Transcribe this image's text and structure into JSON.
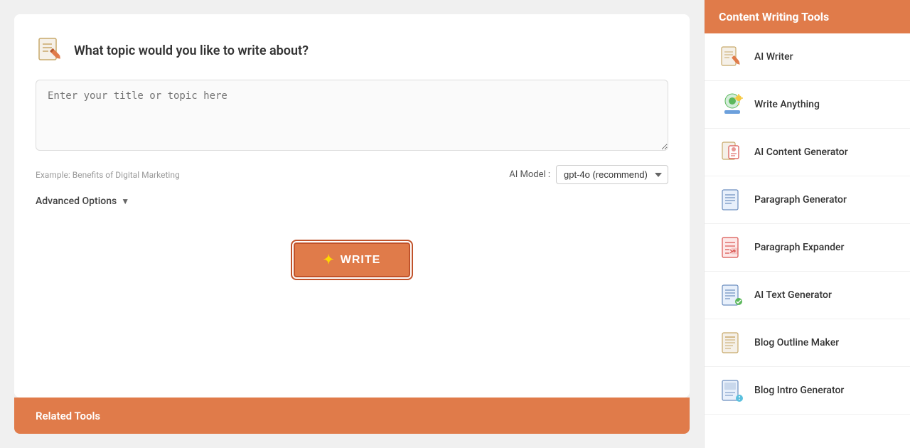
{
  "main": {
    "card": {
      "title": "What topic would you like to write about?",
      "input_placeholder": "Enter your title or topic here",
      "example_text": "Example: Benefits of Digital Marketing",
      "ai_model_label": "AI Model :",
      "ai_model_value": "gpt-4o (recommend)",
      "advanced_options_label": "Advanced Options",
      "write_button_label": "WRITE"
    },
    "related_tools_label": "Related Tools"
  },
  "sidebar": {
    "header": "Content Writing Tools",
    "items": [
      {
        "label": "AI Writer",
        "icon": "ai-writer-icon"
      },
      {
        "label": "Write Anything",
        "icon": "write-anything-icon"
      },
      {
        "label": "AI Content Generator",
        "icon": "ai-content-icon"
      },
      {
        "label": "Paragraph Generator",
        "icon": "paragraph-gen-icon"
      },
      {
        "label": "Paragraph Expander",
        "icon": "paragraph-exp-icon"
      },
      {
        "label": "AI Text Generator",
        "icon": "ai-text-icon"
      },
      {
        "label": "Blog Outline Maker",
        "icon": "blog-outline-icon"
      },
      {
        "label": "Blog Intro Generator",
        "icon": "blog-intro-icon"
      }
    ]
  }
}
